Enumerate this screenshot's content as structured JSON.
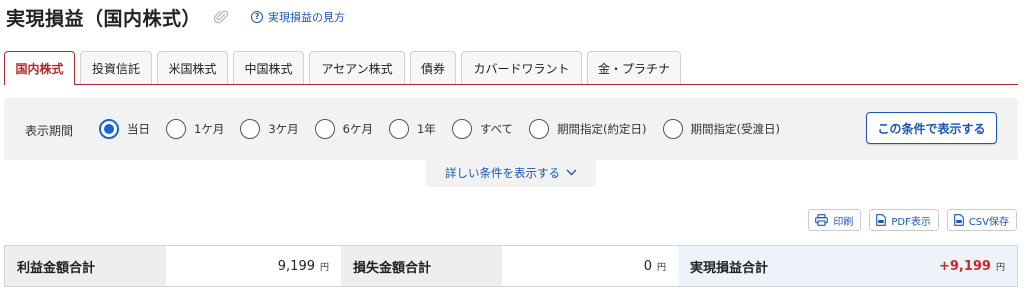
{
  "header": {
    "title": "実現損益（国内株式）",
    "help_link": "実現損益の見方"
  },
  "tabs": [
    {
      "label": "国内株式",
      "active": true
    },
    {
      "label": "投資信託",
      "active": false
    },
    {
      "label": "米国株式",
      "active": false
    },
    {
      "label": "中国株式",
      "active": false
    },
    {
      "label": "アセアン株式",
      "active": false
    },
    {
      "label": "債券",
      "active": false
    },
    {
      "label": "カバードワラント",
      "active": false
    },
    {
      "label": "金・プラチナ",
      "active": false
    }
  ],
  "filter": {
    "label": "表示期間",
    "options": [
      {
        "label": "当日",
        "checked": true
      },
      {
        "label": "1ケ月",
        "checked": false
      },
      {
        "label": "3ケ月",
        "checked": false
      },
      {
        "label": "6ケ月",
        "checked": false
      },
      {
        "label": "1年",
        "checked": false
      },
      {
        "label": "すべて",
        "checked": false
      },
      {
        "label": "期間指定(約定日)",
        "checked": false
      },
      {
        "label": "期間指定(受渡日)",
        "checked": false
      }
    ],
    "submit_label": "この条件で表示する",
    "more_label": "詳しい条件を表示する"
  },
  "actions": {
    "print": "印刷",
    "pdf": "PDF表示",
    "csv": "CSV保存"
  },
  "summary": {
    "profit_label": "利益金額合計",
    "profit_value": "9,199",
    "loss_label": "損失金額合計",
    "loss_value": "0",
    "realized_label": "実現損益合計",
    "realized_value": "+9,199",
    "unit": "円"
  },
  "colors": {
    "accent_red": "#b52b2b",
    "link_blue": "#1a56b8",
    "radio_blue": "#1a63d8",
    "profit_red": "#d0242c"
  }
}
